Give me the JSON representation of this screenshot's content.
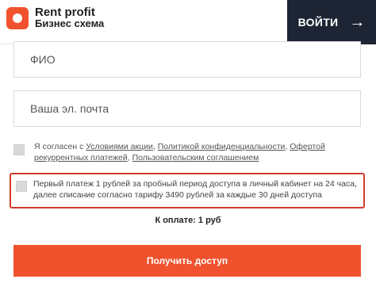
{
  "header": {
    "logo_line1": "Rent profit",
    "logo_line2": "Бизнес схема",
    "login_label": "ВОЙТИ",
    "login_arrow": "→"
  },
  "form": {
    "name_placeholder": "ФИО",
    "email_placeholder": "Ваша эл. почта"
  },
  "agreement": {
    "prefix": "Я согласен с ",
    "link_terms": "Условиями акции",
    "sep1": ", ",
    "link_privacy": "Политикой конфиденциальности",
    "sep2": ", ",
    "link_offer": "Офертой рекуррентных платежей",
    "sep3": ", ",
    "link_user_agreement": "Пользовательским соглашением",
    "checked": false
  },
  "notice": {
    "text": "Первый платеж 1 рублей за пробный период доступа в личный кабинет на 24 часа, далее списание согласно тарифу 3490 рублей за каждые 30 дней доступа",
    "checked": false
  },
  "payment": {
    "amount_label": "К оплате: 1 руб"
  },
  "cta": {
    "label": "Получить доступ"
  },
  "colors": {
    "accent": "#f0522d",
    "dark_button": "#1d2433",
    "notice_border": "#d23a2a"
  }
}
